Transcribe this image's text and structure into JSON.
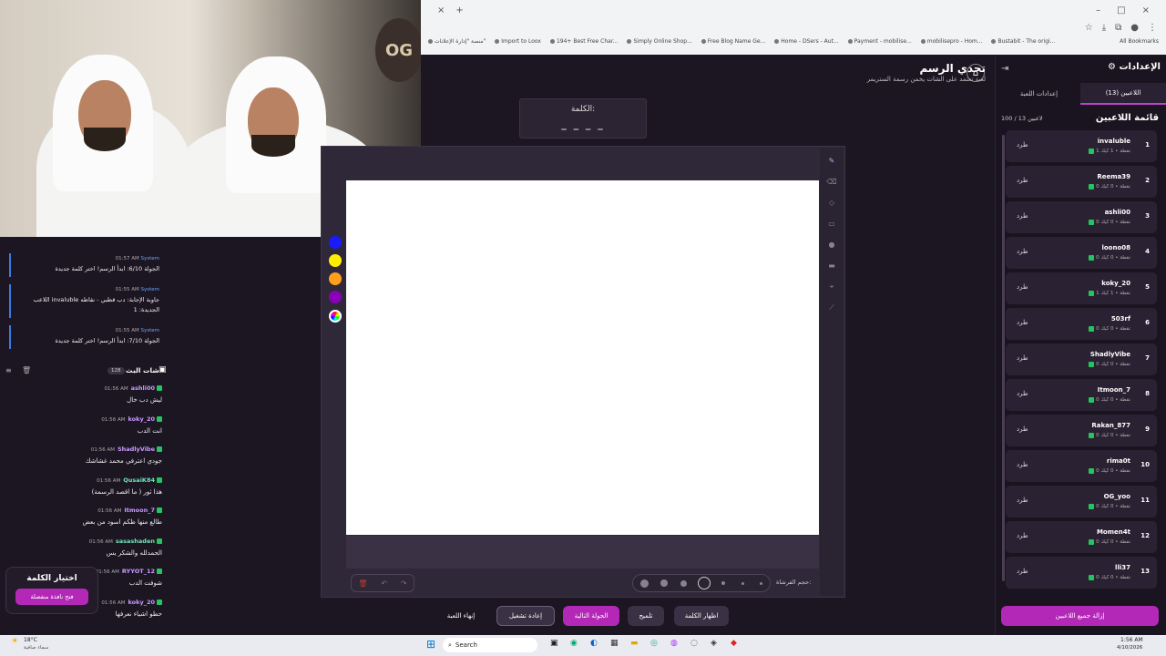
{
  "browser": {
    "new_tab": "+",
    "close_tab": "×",
    "window_controls": [
      "–",
      "□",
      "×"
    ],
    "bookmarks": [
      "منصة \"إدارة الإعلانات\"",
      "Import to Loox",
      "194+ Best Free Char...",
      "Simply Online Shop...",
      "Free Blog Name Ge...",
      "Home - DSers - Aut...",
      "Payment - mobilise...",
      "mobilisepro - Hom...",
      "Bustabit - The origi..."
    ],
    "all_bookmarks": "All Bookmarks"
  },
  "header": {
    "title": "تحدي الرسم",
    "subtitle": "لعبة تعتمد على الشات يخمن رسمة الستريمر"
  },
  "webcam": {
    "logo": "OG"
  },
  "right_panel": {
    "title": "الإعدادات",
    "tabs": {
      "players": "اللاعبين (13)",
      "game_settings": "إعدادات اللعبة"
    },
    "list_title": "قائمة اللاعبين",
    "count": "100 / 13 لاعبين",
    "kick_label": "طرد",
    "players": [
      {
        "num": "1",
        "name": "invaluble",
        "stats": "1 نقطة • 1 كيك"
      },
      {
        "num": "2",
        "name": "Reema39",
        "stats": "0 نقطة • 0 كيك"
      },
      {
        "num": "3",
        "name": "ashli00",
        "stats": "0 نقطة • 0 كيك"
      },
      {
        "num": "4",
        "name": "loono08",
        "stats": "0 نقطة • 0 كيك"
      },
      {
        "num": "5",
        "name": "koky_20",
        "stats": "1 نقطة • 1 كيك"
      },
      {
        "num": "6",
        "name": "503rf",
        "stats": "0 نقطة • 0 كيك"
      },
      {
        "num": "7",
        "name": "ShadlyVibe",
        "stats": "0 نقطة • 0 كيك"
      },
      {
        "num": "8",
        "name": "Itmoon_7",
        "stats": "0 نقطة • 0 كيك"
      },
      {
        "num": "9",
        "name": "Rakan_877",
        "stats": "0 نقطة • 0 كيك"
      },
      {
        "num": "10",
        "name": "rima0t",
        "stats": "0 نقطة • 0 كيك"
      },
      {
        "num": "11",
        "name": "OG_yoo",
        "stats": "0 نقطة • 0 كيك"
      },
      {
        "num": "12",
        "name": "Momen4t",
        "stats": "0 نقطة • 0 كيك"
      },
      {
        "num": "13",
        "name": "lli37",
        "stats": "0 نقطة • 0 كيك"
      }
    ],
    "remove_all": "إزالة جميع اللاعبين"
  },
  "word_box": {
    "label": "الكلمة:",
    "dashes": "_ _ _ _"
  },
  "brush": {
    "label": "حجم الفرشاة:"
  },
  "buttons": {
    "show_word": "اظهار الكلمة",
    "hint": "تلميح",
    "next_round": "الجولة التالية",
    "restart": "إعادة تشغيل",
    "end_game": "إنهاء اللعبة"
  },
  "system_messages": [
    {
      "sender": "System",
      "time": "01:57 AM",
      "text": "الجولة 6/10: ابدأ الرسم! اختر كلمة جديدة"
    },
    {
      "sender": "System",
      "time": "01:55 AM",
      "text": "اللاعب invaluble جاوبة الإجابة: دب قطبي - نقاطه الجديدة: 1"
    },
    {
      "sender": "System",
      "time": "01:55 AM",
      "text": "الجولة 7/10: ابدأ الرسم! اختر كلمة جديدة"
    }
  ],
  "chat": {
    "title": "شات البث",
    "count": "128",
    "messages": [
      {
        "user": "ashli00",
        "time": "01:56 AM",
        "text": "ليش دب خال",
        "color": "#c89bff"
      },
      {
        "user": "koky_20",
        "time": "01:56 AM",
        "text": "انت الدب",
        "color": "#c89bff"
      },
      {
        "user": "ShadlyVibe",
        "time": "01:56 AM",
        "text": "جودي اعترفي محمد غشاشك",
        "color": "#c89bff"
      },
      {
        "user": "QusaiK84",
        "time": "01:56 AM",
        "text": "هذا ثور ( ما اقصد الرسمة)",
        "color": "#6ee7b7"
      },
      {
        "user": "Itmoon_7",
        "time": "01:56 AM",
        "text": "طالع منها ظكم اسود من بعض",
        "color": "#c89bff"
      },
      {
        "user": "sasashaden",
        "time": "01:56 AM",
        "text": "الحمدلله والشكر يس",
        "color": "#6ee7b7"
      },
      {
        "user": "RYYOT_12",
        "time": "01:56 AM",
        "text": "شوفت الدب",
        "color": "#c89bff"
      },
      {
        "user": "koky_20",
        "time": "01:56 AM",
        "text": "حطو اشياء نعرفها",
        "color": "#c89bff"
      }
    ]
  },
  "pick_word": {
    "title": "اختيار الكلمة",
    "button": "فتح نافذة منفصلة"
  },
  "palette": [
    "#1a1aff",
    "#ffee00",
    "#ff9f1a",
    "#8a00b8"
  ],
  "taskbar": {
    "weather": "18°C",
    "weather_sub": "سماء صافية",
    "search": "Search",
    "time": "1:56 AM",
    "date": "4/10/2026"
  }
}
